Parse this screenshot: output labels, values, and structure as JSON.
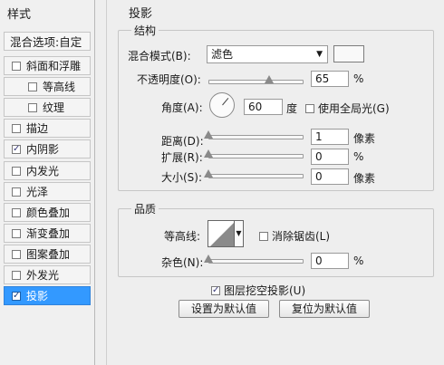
{
  "left_panel": {
    "title": "样式",
    "blend_options": "混合选项:自定",
    "items": [
      {
        "label": "斜面和浮雕",
        "checked": false,
        "indent": false,
        "selected": false
      },
      {
        "label": "等高线",
        "checked": false,
        "indent": true,
        "selected": false
      },
      {
        "label": "纹理",
        "checked": false,
        "indent": true,
        "selected": false
      },
      {
        "label": "描边",
        "checked": false,
        "indent": false,
        "selected": false
      },
      {
        "label": "内阴影",
        "checked": true,
        "indent": false,
        "selected": false
      },
      {
        "label": "内发光",
        "checked": false,
        "indent": false,
        "selected": false
      },
      {
        "label": "光泽",
        "checked": false,
        "indent": false,
        "selected": false
      },
      {
        "label": "颜色叠加",
        "checked": false,
        "indent": false,
        "selected": false
      },
      {
        "label": "渐变叠加",
        "checked": false,
        "indent": false,
        "selected": false
      },
      {
        "label": "图案叠加",
        "checked": false,
        "indent": false,
        "selected": false
      },
      {
        "label": "外发光",
        "checked": false,
        "indent": false,
        "selected": false
      },
      {
        "label": "投影",
        "checked": true,
        "indent": false,
        "selected": true
      }
    ]
  },
  "main": {
    "title": "投影",
    "structure": {
      "title": "结构",
      "blend_mode_label": "混合模式(B):",
      "blend_mode_value": "滤色",
      "color": "#f9f9f9",
      "opacity_label": "不透明度(O):",
      "opacity_value": "65",
      "opacity_percent": 0.65,
      "opacity_unit": "%",
      "angle_label": "角度(A):",
      "angle_value": "60",
      "angle_unit": "度",
      "global_light_label": "使用全局光(G)",
      "global_light_checked": false,
      "distance_label": "距离(D):",
      "distance_value": "1",
      "distance_unit": "像素",
      "spread_label": "扩展(R):",
      "spread_value": "0",
      "spread_unit": "%",
      "size_label": "大小(S):",
      "size_value": "0",
      "size_unit": "像素"
    },
    "quality": {
      "title": "品质",
      "contour_label": "等高线:",
      "antialias_label": "消除锯齿(L)",
      "antialias_checked": false,
      "noise_label": "杂色(N):",
      "noise_value": "0",
      "noise_unit": "%"
    },
    "knockout_label": "图层挖空投影(U)",
    "knockout_checked": true,
    "make_default_label": "设置为默认值",
    "reset_default_label": "复位为默认值"
  }
}
